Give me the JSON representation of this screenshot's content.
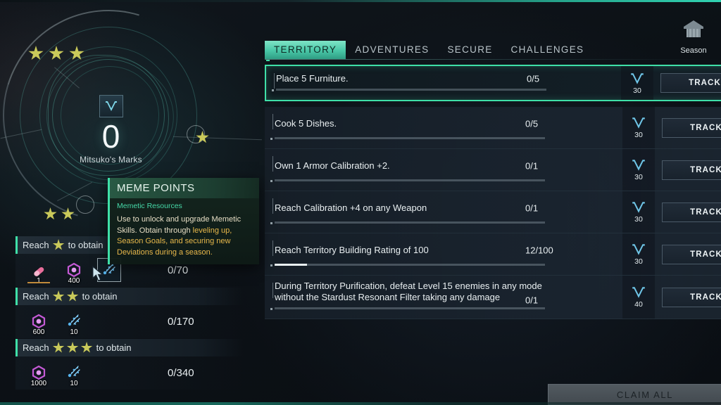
{
  "theme": {
    "accent": "#3fe0a8",
    "panel_bg": "#1a2430",
    "text": "#e9eff1",
    "gold": "#e8b84b",
    "star": "#c9c95a"
  },
  "left": {
    "core": {
      "icon": "mitsuko-mark-icon",
      "value": "0",
      "label": "Mitsuko's Marks"
    },
    "tooltip": {
      "title": "MEME POINTS",
      "subtitle": "Memetic Resources",
      "body_line1": "Use to unlock and upgrade Memetic Skills.",
      "body_line2_pre": "Obtain through ",
      "body_line2_hl": "leveling up, Season Goals,",
      "body_line3_hl": "and securing new Deviations",
      "body_line3_post": " during a",
      "body_line4": "season."
    },
    "tiers": [
      {
        "prefix": "Reach",
        "suffix": "to obtain",
        "stars": 1,
        "value": "0/70",
        "items": [
          {
            "icon": "pink-capsule-icon",
            "qty": "1",
            "boxed": false,
            "underlined": true
          },
          {
            "icon": "purple-hex-icon",
            "qty": "400",
            "boxed": false,
            "underlined": false
          },
          {
            "icon": "blue-sparkle-icon",
            "qty": "",
            "boxed": true,
            "underlined": false
          }
        ],
        "cursor": true
      },
      {
        "prefix": "Reach",
        "suffix": "to obtain",
        "stars": 2,
        "value": "0/170",
        "items": [
          {
            "icon": "purple-hex-icon",
            "qty": "600",
            "boxed": false,
            "underlined": false
          },
          {
            "icon": "blue-sparkle-icon",
            "qty": "10",
            "boxed": false,
            "underlined": false
          }
        ],
        "cursor": false
      },
      {
        "prefix": "Reach",
        "suffix": "to obtain",
        "stars": 3,
        "value": "0/340",
        "items": [
          {
            "icon": "purple-hex-icon",
            "qty": "1000",
            "boxed": false,
            "underlined": false
          },
          {
            "icon": "blue-sparkle-icon",
            "qty": "10",
            "boxed": false,
            "underlined": false
          }
        ],
        "cursor": false
      }
    ]
  },
  "right": {
    "tabs": [
      {
        "label": "TERRITORY",
        "active": true
      },
      {
        "label": "ADVENTURES",
        "active": false
      },
      {
        "label": "SECURE",
        "active": false
      },
      {
        "label": "CHALLENGES",
        "active": false
      }
    ],
    "season_badge": {
      "icon": "season-trophy-icon",
      "label": "Season"
    },
    "track_label": "TRACK",
    "claim_all_label": "CLAIM ALL",
    "tasks": [
      {
        "text": "Place 5 Furniture.",
        "count": "0/5",
        "progress_percent": 0,
        "reward_icon": "meme-point-icon",
        "reward_qty": "30",
        "highlighted": true,
        "two_line": false
      },
      {
        "text": "Cook 5 Dishes.",
        "count": "0/5",
        "progress_percent": 0,
        "reward_icon": "meme-point-icon",
        "reward_qty": "30",
        "highlighted": false,
        "two_line": false
      },
      {
        "text": "Own 1 Armor Calibration +2.",
        "count": "0/1",
        "progress_percent": 0,
        "reward_icon": "meme-point-icon",
        "reward_qty": "30",
        "highlighted": false,
        "two_line": false
      },
      {
        "text": "Reach Calibration +4 on any Weapon",
        "count": "0/1",
        "progress_percent": 0,
        "reward_icon": "meme-point-icon",
        "reward_qty": "30",
        "highlighted": false,
        "two_line": false
      },
      {
        "text": "Reach Territory Building Rating of 100",
        "count": "12/100",
        "progress_percent": 12,
        "reward_icon": "meme-point-icon",
        "reward_qty": "30",
        "highlighted": false,
        "two_line": false
      },
      {
        "text": "During Territory Purification, defeat Level 15 enemies in any mode without the Stardust Resonant Filter taking any damage",
        "count": "0/1",
        "progress_percent": 0,
        "reward_icon": "meme-point-icon",
        "reward_qty": "40",
        "highlighted": false,
        "two_line": true
      }
    ]
  }
}
